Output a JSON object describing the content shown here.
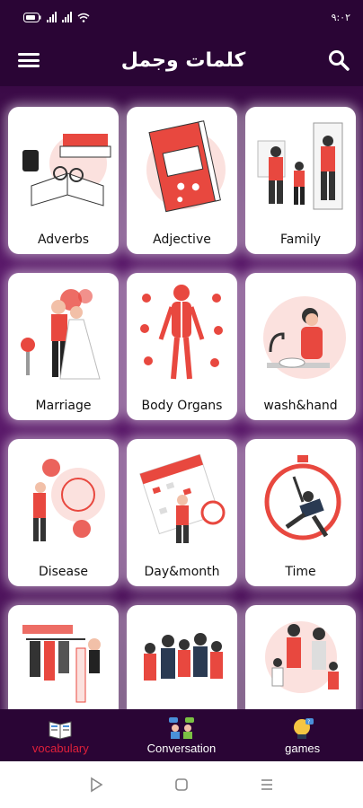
{
  "statusbar": {
    "time": "٩:٠٢"
  },
  "appbar": {
    "title": "كلمات وجمل"
  },
  "categories": [
    {
      "label": "Adverbs"
    },
    {
      "label": "Adjective"
    },
    {
      "label": "Family"
    },
    {
      "label": "Marriage"
    },
    {
      "label": "Body Organs"
    },
    {
      "label": "wash&hand"
    },
    {
      "label": "Disease"
    },
    {
      "label": "Day&month"
    },
    {
      "label": "Time"
    },
    {
      "label": ""
    },
    {
      "label": ""
    },
    {
      "label": ""
    }
  ],
  "bottom_nav": [
    {
      "label": "vocabulary",
      "icon": "book-icon",
      "active": true
    },
    {
      "label": "Conversation",
      "icon": "conversation-icon",
      "active": false
    },
    {
      "label": "games",
      "icon": "games-icon",
      "active": false
    }
  ],
  "colors": {
    "bar": "#2a0535",
    "accent": "#e0203a",
    "illustration": "#e8483f"
  }
}
